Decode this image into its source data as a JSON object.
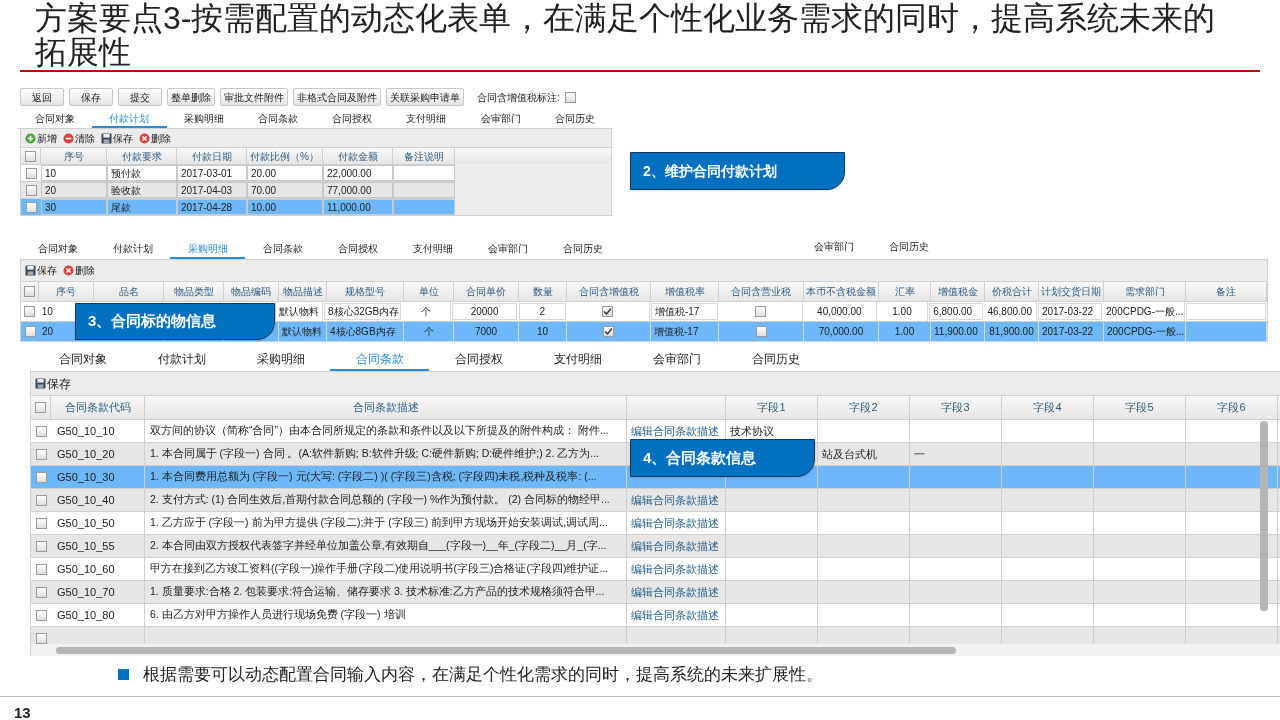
{
  "title": "方案要点3-按需配置的动态化表单，在满足个性化业务需求的同时，提高系统未来的拓展性",
  "payment_panel": {
    "buttons": [
      "返回",
      "保存",
      "提交",
      "整单删除",
      "审批文件附件",
      "非格式合同及附件",
      "关联采购申请单"
    ],
    "tax_flag": {
      "label": "合同含增值税标注:",
      "checked": false
    },
    "tabs": [
      {
        "label": "合同对象",
        "selected": false
      },
      {
        "label": "付款计划",
        "selected": true
      },
      {
        "label": "采购明细",
        "selected": false
      },
      {
        "label": "合同条款",
        "selected": false
      },
      {
        "label": "合同授权",
        "selected": false
      },
      {
        "label": "支付明细",
        "selected": false
      },
      {
        "label": "会审部门",
        "selected": false
      },
      {
        "label": "合同历史",
        "selected": false
      }
    ],
    "toolbar": [
      {
        "kind": "add",
        "label": "新增"
      },
      {
        "kind": "clear",
        "label": "清除"
      },
      {
        "kind": "save",
        "label": "保存"
      },
      {
        "kind": "delete",
        "label": "删除"
      }
    ],
    "table": {
      "header_checked": false,
      "columns": [
        "序号",
        "付款要求",
        "付款日期",
        "付款比例（%）",
        "付款金额",
        "备注说明"
      ],
      "rows": [
        {
          "checked": false,
          "selected": false,
          "cells": [
            "10",
            "预付款",
            "2017-03-01",
            "20.00",
            "22,000.00"
          ]
        },
        {
          "checked": false,
          "selected": false,
          "cells": [
            "20",
            "验收款",
            "2017-04-03",
            "70.00",
            "77,000.00"
          ]
        },
        {
          "checked": false,
          "selected": true,
          "cells": [
            "30",
            "尾款",
            "2017-04-28",
            "10.00",
            "11,000.00"
          ]
        }
      ]
    },
    "callout": "2、维护合同付款计划"
  },
  "purchase_panel": {
    "tabs": [
      {
        "label": "合同对象",
        "selected": false
      },
      {
        "label": "付款计划",
        "selected": false
      },
      {
        "label": "采购明细",
        "selected": true
      },
      {
        "label": "合同条款",
        "selected": false
      },
      {
        "label": "合同授权",
        "selected": false
      },
      {
        "label": "支付明细",
        "selected": false
      },
      {
        "label": "会审部门",
        "selected": false
      },
      {
        "label": "合同历史",
        "selected": false
      }
    ],
    "extra_tabs": [
      "会审部门",
      "合同历史"
    ],
    "toolbar": [
      {
        "kind": "save",
        "label": "保存"
      },
      {
        "kind": "delete",
        "label": "删除"
      }
    ],
    "table": {
      "header_checked": false,
      "columns": [
        "序号",
        "品名",
        "物品类型",
        "物品编码",
        "物品描述",
        "规格型号",
        "单位",
        "合同单价",
        "数量",
        "合同含增值税",
        "增值税率",
        "合同含营业税",
        "本币不含税金额",
        "汇率",
        "增值税金",
        "价税合计",
        "计划交货日期",
        "需求部门",
        "备注"
      ],
      "rows": [
        {
          "checked": false,
          "selected": false,
          "seq": "10",
          "description": "默认物料",
          "spec": "8核心32GB内存",
          "unit": "个",
          "price": "20000",
          "qty": "2",
          "vat_included": true,
          "vat_rate": "增值税-17",
          "business_tax_included": false,
          "net_amount": "40,000.00",
          "exchange_rate": "1.00",
          "vat_amount": "6,800.00",
          "total": "46,800.00",
          "delivery_date": "2017-03-22",
          "department": "200CPDG-一般..."
        },
        {
          "checked": false,
          "selected": true,
          "seq": "20",
          "description": "默认物料",
          "spec": "4核心8GB内存",
          "unit": "个",
          "price": "7000",
          "qty": "10",
          "vat_included": true,
          "vat_rate": "增值税-17",
          "business_tax_included": false,
          "net_amount": "70,000.00",
          "exchange_rate": "1.00",
          "vat_amount": "11,900.00",
          "total": "81,900.00",
          "delivery_date": "2017-03-22",
          "department": "200CPDG-一般..."
        }
      ]
    },
    "callout": "3、合同标的物信息"
  },
  "terms_panel": {
    "tabs": [
      {
        "label": "合同对象",
        "selected": false
      },
      {
        "label": "付款计划",
        "selected": false
      },
      {
        "label": "采购明细",
        "selected": false
      },
      {
        "label": "合同条款",
        "selected": true
      },
      {
        "label": "合同授权",
        "selected": false
      },
      {
        "label": "支付明细",
        "selected": false
      },
      {
        "label": "会审部门",
        "selected": false
      },
      {
        "label": "合同历史",
        "selected": false
      }
    ],
    "toolbar": [
      {
        "kind": "save",
        "label": "保存"
      }
    ],
    "table": {
      "header_checked": false,
      "columns": [
        "合同条款代码",
        "合同条款描述",
        "字段1",
        "字段2",
        "字段3",
        "字段4",
        "字段5",
        "字段6"
      ],
      "rows": [
        {
          "checked": false,
          "selected": false,
          "code": "G50_10_10",
          "description": "双方间的协议（简称“合同”）由本合同所规定的条款和条件以及以下所提及的附件构成： 附件...",
          "link": "编辑合同条款描述",
          "field_1": "技术协议"
        },
        {
          "checked": false,
          "selected": false,
          "code": "G50_10_20",
          "description": "1. 本合同属于 (字段一) 合同 。(A:软件新购; B:软件升级; C:硬件新购; D:硬件维护;) 2. 乙方为...",
          "field_2": "站及台式机",
          "field_3": "一"
        },
        {
          "checked": false,
          "selected": true,
          "code": "G50_10_30",
          "description": "1. 本合同费用总额为 (字段一) 元(大写: (字段二) )( (字段三)含税; (字段四)未税,税种及税率: (..."
        },
        {
          "checked": false,
          "selected": false,
          "code": "G50_10_40",
          "description": "2. 支付方式: (1) 合同生效后,首期付款合同总额的 (字段一) %作为预付款。 (2) 合同标的物经甲...",
          "link": "编辑合同条款描述"
        },
        {
          "checked": false,
          "selected": false,
          "code": "G50_10_50",
          "description": "1. 乙方应于 (字段一) 前为甲方提供 (字段二);并于 (字段三) 前到甲方现场开始安装调试,调试周...",
          "link": "编辑合同条款描述"
        },
        {
          "checked": false,
          "selected": false,
          "code": "G50_10_55",
          "description": "2. 本合同由双方授权代表签字并经单位加盖公章,有效期自___(字段一)__年_(字段二)__月_(字...",
          "link": "编辑合同条款描述"
        },
        {
          "checked": false,
          "selected": false,
          "code": "G50_10_60",
          "description": "甲方在接到乙方竣工资料((字段一)操作手册(字段二)使用说明书(字段三)合格证(字段四)维护证...",
          "link": "编辑合同条款描述"
        },
        {
          "checked": false,
          "selected": false,
          "code": "G50_10_70",
          "description": "1. 质量要求:合格 2. 包装要求:符合运输、储存要求 3. 技术标准:乙方产品的技术规格须符合甲...",
          "link": "编辑合同条款描述"
        },
        {
          "checked": false,
          "selected": false,
          "code": "G50_10_80",
          "description": "6. 由乙方对甲方操作人员进行现场免费 (字段一) 培训",
          "link": "编辑合同条款描述"
        },
        {
          "checked": false,
          "selected": false
        }
      ]
    },
    "callout": "4、合同条款信息"
  },
  "note": "根据需要可以动态配置合同输入内容，在满足个性化需求的同时，提高系统的未来扩展性。",
  "page_number": "13"
}
